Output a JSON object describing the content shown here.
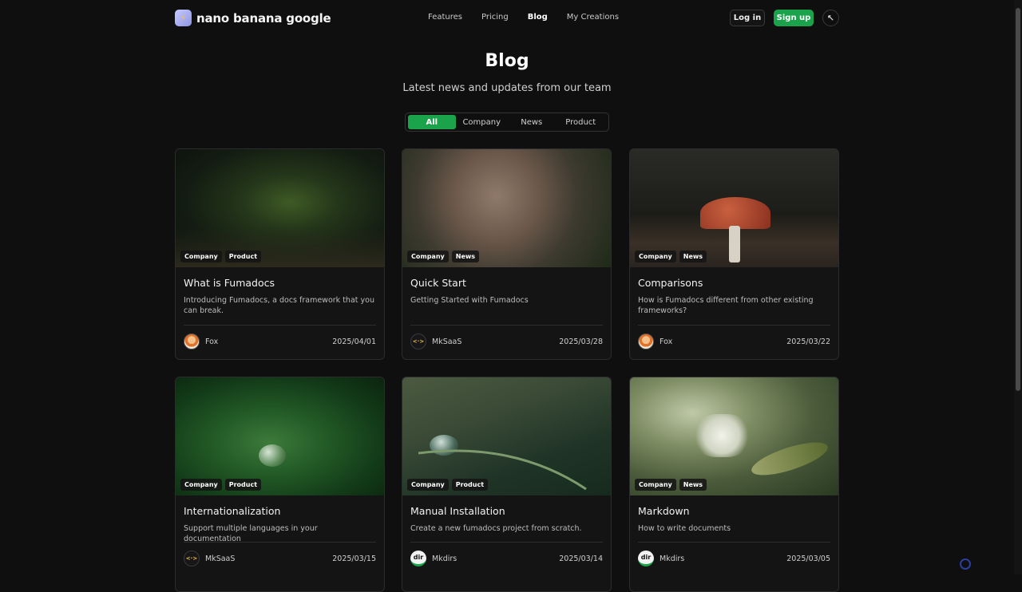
{
  "brand": {
    "name": "nano banana google",
    "logo_icon": "lightning-bolt"
  },
  "nav": {
    "items": [
      "Features",
      "Pricing",
      "Blog",
      "My Creations"
    ],
    "active": "Blog"
  },
  "actions": {
    "login": "Log in",
    "signup": "Sign up",
    "theme_icon": "theme-toggle"
  },
  "hero": {
    "title": "Blog",
    "subtitle": "Latest news and updates from our team"
  },
  "filter": {
    "tabs": [
      "All",
      "Company",
      "News",
      "Product"
    ],
    "active": "All"
  },
  "colors": {
    "accent": "#1aa34a",
    "background": "#0f0f10",
    "card": "#141415",
    "border": "#2c2c2e"
  },
  "posts": [
    {
      "title": "What is Fumadocs",
      "description": "Introducing Fumadocs, a docs framework that you can break.",
      "tags": [
        "Company",
        "Product"
      ],
      "author": "Fox",
      "avatar": "fox",
      "date": "2025/04/01"
    },
    {
      "title": "Quick Start",
      "description": "Getting Started with Fumadocs",
      "tags": [
        "Company",
        "News"
      ],
      "author": "MkSaaS",
      "avatar": "code",
      "date": "2025/03/28"
    },
    {
      "title": "Comparisons",
      "description": "How is Fumadocs different from other existing frameworks?",
      "tags": [
        "Company",
        "News"
      ],
      "author": "Fox",
      "avatar": "fox",
      "date": "2025/03/22"
    },
    {
      "title": "Internationalization",
      "description": "Support multiple languages in your documentation",
      "tags": [
        "Company",
        "Product"
      ],
      "author": "MkSaaS",
      "avatar": "code",
      "date": "2025/03/15"
    },
    {
      "title": "Manual Installation",
      "description": "Create a new fumadocs project from scratch.",
      "tags": [
        "Company",
        "Product"
      ],
      "author": "Mkdirs",
      "avatar": "dir",
      "date": "2025/03/14"
    },
    {
      "title": "Markdown",
      "description": "How to write documents",
      "tags": [
        "Company",
        "News"
      ],
      "author": "Mkdirs",
      "avatar": "dir",
      "date": "2025/03/05"
    }
  ],
  "avatar_text": {
    "code": "<·>",
    "dir": "dir"
  }
}
